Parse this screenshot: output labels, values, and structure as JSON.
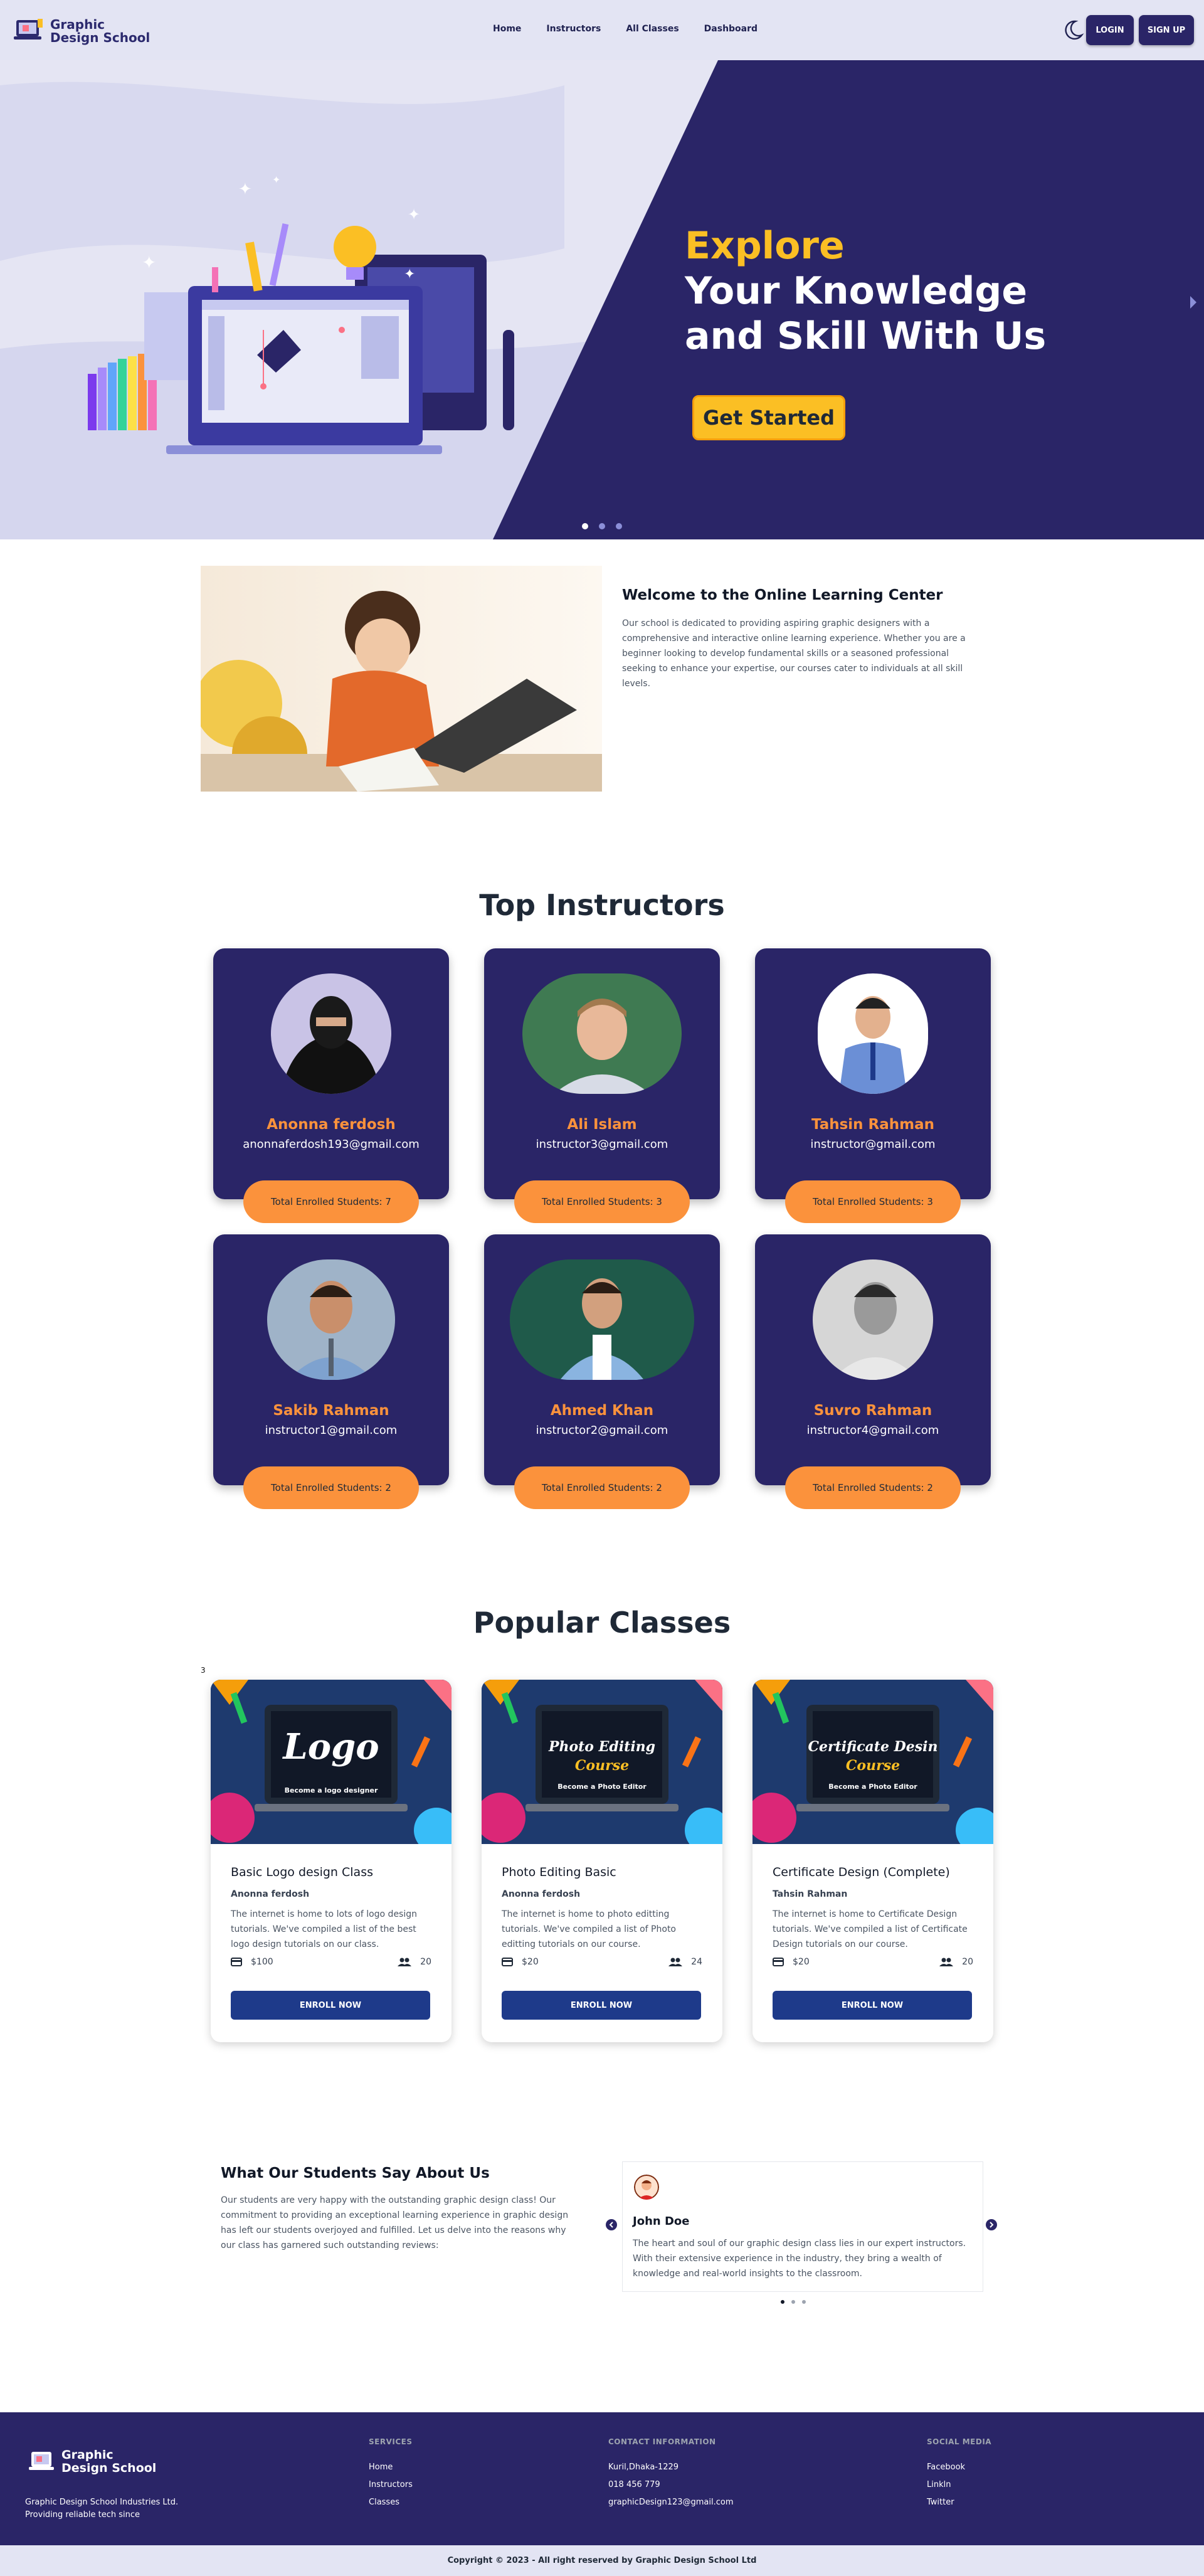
{
  "nav": {
    "logo_line1": "Graphic",
    "logo_line2": "Design School",
    "menu": [
      "Home",
      "Instructors",
      "All Classes",
      "Dashboard"
    ],
    "login": "LOGIN",
    "signup": "SIGN UP"
  },
  "hero": {
    "line1": "Explore",
    "line2": "Your Knowledge",
    "line3": "and Skill With Us",
    "cta": "Get Started",
    "slide_count": 3,
    "active_slide": 1
  },
  "welcome": {
    "title": "Welcome to the Online Learning Center",
    "text": "Our school is dedicated to providing aspiring graphic designers with a comprehensive and interactive online learning experience. Whether you are a beginner looking to develop fundamental skills or a seasoned professional seeking to enhance your expertise, our courses cater to individuals at all skill levels."
  },
  "instructors": {
    "title": "Top Instructors",
    "items": [
      {
        "name": "Anonna ferdosh",
        "email": "anonnaferdosh193@gmail.com",
        "students": "Total Enrolled Students: 7"
      },
      {
        "name": "Ali Islam",
        "email": "instructor3@gmail.com",
        "students": "Total Enrolled Students: 3"
      },
      {
        "name": "Tahsin Rahman",
        "email": "instructor@gmail.com",
        "students": "Total Enrolled Students: 3"
      },
      {
        "name": "Sakib Rahman",
        "email": "instructor1@gmail.com",
        "students": "Total Enrolled Students: 2"
      },
      {
        "name": "Ahmed Khan",
        "email": "instructor2@gmail.com",
        "students": "Total Enrolled Students: 2"
      },
      {
        "name": "Suvro Rahman",
        "email": "instructor4@gmail.com",
        "students": "Total Enrolled Students: 2"
      }
    ]
  },
  "classes": {
    "title": "Popular Classes",
    "count_label": "3",
    "items": [
      {
        "banner_main": "Logo",
        "banner_sub": "Become a logo designer",
        "title": "Basic Logo design Class",
        "instructor": "Anonna ferdosh",
        "desc": "The internet is home to lots of logo design tutorials. We've compiled a list of the best logo design tutorials on our class.",
        "price": "$100",
        "seats": "20",
        "cta": "ENROLL NOW"
      },
      {
        "banner_main": "Photo Editing",
        "banner_accent": "Course",
        "banner_sub": "Become a Photo Editor",
        "title": "Photo Editing Basic",
        "instructor": "Anonna ferdosh",
        "desc": "The internet is home to photo editting tutorials. We've compiled a list of Photo editting tutorials on our course.",
        "price": "$20",
        "seats": "24",
        "cta": "ENROLL NOW"
      },
      {
        "banner_main": "Certificate Desin",
        "banner_accent": "Course",
        "banner_sub": "Become a Photo Editor",
        "title": "Certificate Design (Complete)",
        "instructor": "Tahsin Rahman",
        "desc": "The internet is home to Certificate Design tutorials. We've compiled a list of Certificate Design tutorials on our course.",
        "price": "$20",
        "seats": "20",
        "cta": "ENROLL NOW"
      }
    ]
  },
  "testimonials": {
    "title": "What Our Students Say About Us",
    "text": "Our students are very happy with the outstanding graphic design class! Our commitment to providing an exceptional learning experience in graphic design has left our students overjoyed and fulfilled. Let us delve into the reasons why our class has garnered such outstanding reviews:",
    "name": "John Doe",
    "quote": "The heart and soul of our graphic design class lies in our expert instructors. With their extensive experience in the industry, they bring a wealth of knowledge and real-world insights to the classroom."
  },
  "footer": {
    "logo_line1": "Graphic",
    "logo_line2": "Design School",
    "company": "Graphic Design School Industries Ltd.",
    "tagline": "Providing reliable tech since",
    "services_head": "SERVICES",
    "services": [
      "Home",
      "Instructors",
      "Classes"
    ],
    "contact_head": "CONTACT INFORMATION",
    "contact": [
      "Kuril,Dhaka-1229",
      "018 456 779",
      "graphicDesign123@gmail.com"
    ],
    "social_head": "SOCIAL MEDIA",
    "social": [
      "Facebook",
      "Linkln",
      "Twitter"
    ],
    "copyright": "Copyright © 2023 - All right reserved by Graphic Design School Ltd"
  },
  "colors": {
    "primary": "#2a2567",
    "accent": "#fbbf24",
    "orange": "#fb923c",
    "button": "#1e3a8a",
    "nav_bg": "#e3e4f3"
  }
}
